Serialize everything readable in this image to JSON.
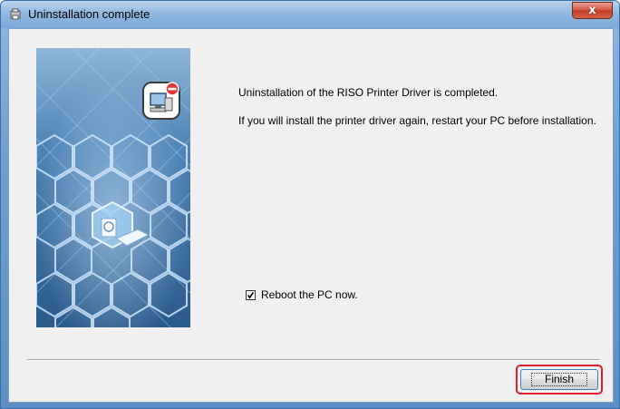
{
  "window": {
    "title": "Uninstallation complete",
    "close_glyph": "x"
  },
  "message": {
    "line1": "Uninstallation of the RISO Printer Driver is completed.",
    "line2": "If you will install the printer driver again, restart your PC before installation."
  },
  "reboot": {
    "label": "Reboot the PC now.",
    "checked": true
  },
  "footer": {
    "finish_label": "Finish"
  },
  "icons": {
    "app": "installer-icon",
    "close": "close-icon",
    "badge": "pc-remove-icon",
    "printer": "printer-icon"
  },
  "colors": {
    "highlight": "#e0202a",
    "panel_bg": "#f0f0f0",
    "graphic_bg": "#2f5f8e"
  }
}
